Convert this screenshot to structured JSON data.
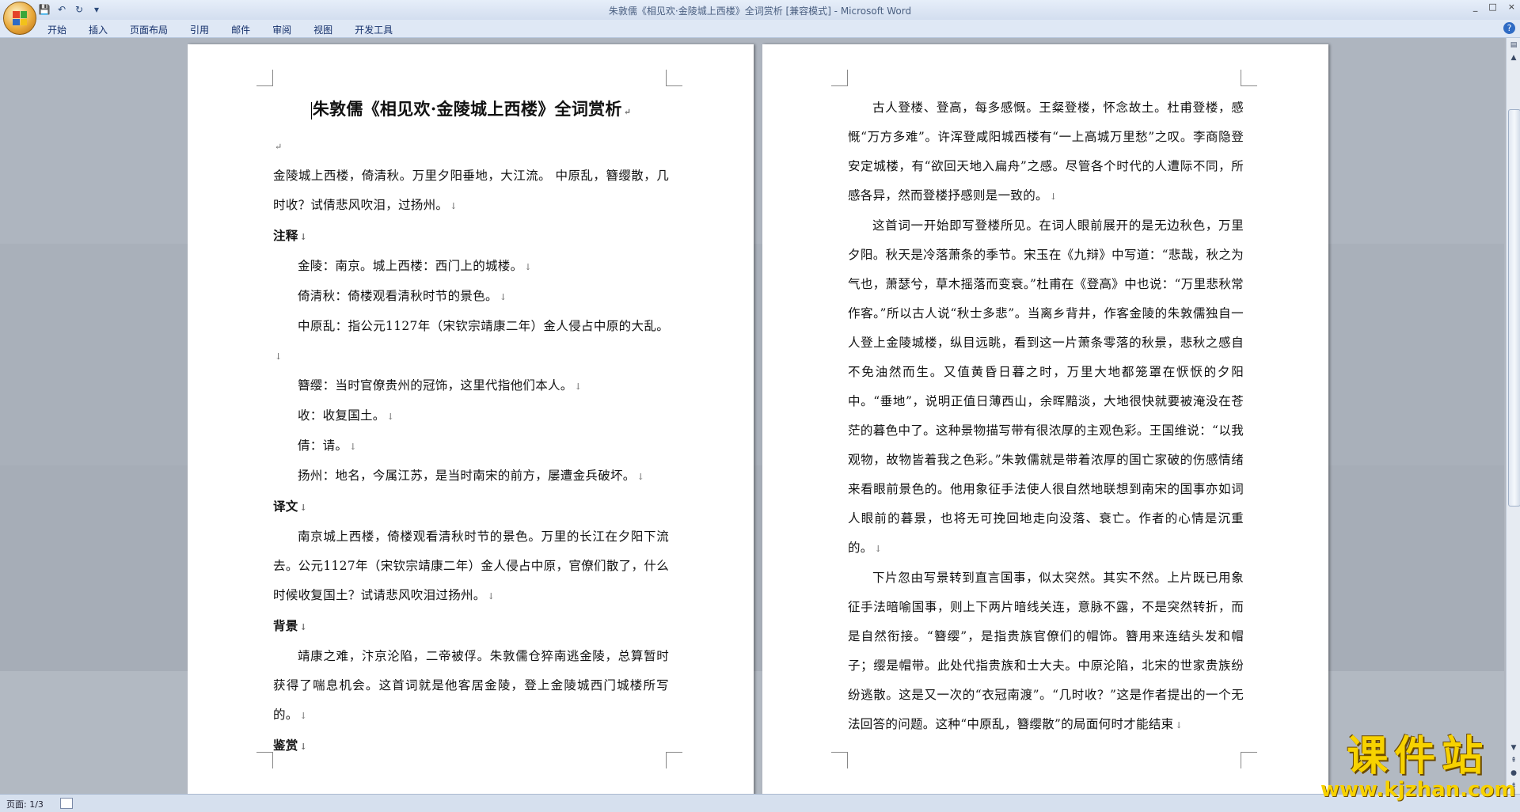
{
  "window": {
    "title": "朱敦儒《相见欢·金陵城上西楼》全词赏析 [兼容模式] - Microsoft Word",
    "controls": [
      "_",
      "□",
      "×"
    ],
    "help": "?"
  },
  "quick_access": {
    "save": "💾",
    "undo": "↶",
    "redo": "↻",
    "more": "▾"
  },
  "ribbon_tabs": [
    "开始",
    "插入",
    "页面布局",
    "引用",
    "邮件",
    "审阅",
    "视图",
    "开发工具"
  ],
  "page1": {
    "title": "朱敦儒《相见欢·金陵城上西楼》全词赏析",
    "paragraphs": [
      {
        "style": "plain",
        "text": "金陵城上西楼，倚清秋。万里夕阳垂地，大江流。 中原乱，簪缨散，几时收？试倩悲风吹泪，过扬州。"
      },
      {
        "style": "heading",
        "text": "注释"
      },
      {
        "style": "indent",
        "text": "金陵：南京。城上西楼：西门上的城楼。"
      },
      {
        "style": "indent",
        "text": "倚清秋：倚楼观看清秋时节的景色。"
      },
      {
        "style": "indent",
        "text": "中原乱：指公元1127年（宋钦宗靖康二年）金人侵占中原的大乱。"
      },
      {
        "style": "indent",
        "text": "簪缨：当时官僚贵州的冠饰，这里代指他们本人。"
      },
      {
        "style": "indent",
        "text": "收：收复国土。"
      },
      {
        "style": "indent",
        "text": "倩：请。"
      },
      {
        "style": "indent",
        "text": "扬州：地名，今属江苏，是当时南宋的前方，屡遭金兵破坏。"
      },
      {
        "style": "heading",
        "text": "译文"
      },
      {
        "style": "indent",
        "text": "南京城上西楼，倚楼观看清秋时节的景色。万里的长江在夕阳下流去。公元1127年（宋钦宗靖康二年）金人侵占中原，官僚们散了，什么时候收复国土？试请悲风吹泪过扬州。"
      },
      {
        "style": "heading",
        "text": "背景"
      },
      {
        "style": "indent",
        "text": "靖康之难，汴京沦陷，二帝被俘。朱敦儒仓猝南逃金陵，总算暂时获得了喘息机会。这首词就是他客居金陵，登上金陵城西门城楼所写的。"
      },
      {
        "style": "heading",
        "text": "鉴赏"
      }
    ]
  },
  "page2": {
    "paragraphs": [
      {
        "style": "indent",
        "text": "古人登楼、登高，每多感慨。王粲登楼，怀念故土。杜甫登楼，感慨“万方多难”。许浑登咸阳城西楼有“一上高城万里愁”之叹。李商隐登安定城楼，有“欲回天地入扁舟”之感。尽管各个时代的人遭际不同，所感各异，然而登楼抒感则是一致的。"
      },
      {
        "style": "indent",
        "text": "这首词一开始即写登楼所见。在词人眼前展开的是无边秋色，万里夕阳。秋天是冷落萧条的季节。宋玉在《九辩》中写道：“悲哉，秋之为气也，萧瑟兮，草木摇落而变衰。”杜甫在《登高》中也说：“万里悲秋常作客。”所以古人说“秋士多悲”。当离乡背井，作客金陵的朱敦儒独自一人登上金陵城楼，纵目远眺，看到这一片萧条零落的秋景，悲秋之感自不免油然而生。又值黄昏日暮之时，万里大地都笼罩在恹恹的夕阳中。“垂地”，说明正值日薄西山，余晖黯淡，大地很快就要被淹没在苍茫的暮色中了。这种景物描写带有很浓厚的主观色彩。王国维说：“以我观物，故物皆着我之色彩。”朱敦儒就是带着浓厚的国亡家破的伤感情绪来看眼前景色的。他用象征手法使人很自然地联想到南宋的国事亦如词人眼前的暮景，也将无可挽回地走向没落、衰亡。作者的心情是沉重的。"
      },
      {
        "style": "indent",
        "text": "下片忽由写景转到直言国事，似太突然。其实不然。上片既已用象征手法暗喻国事，则上下两片暗线关连，意脉不露，不是突然转折，而是自然衔接。“簪缨”，是指贵族官僚们的帽饰。簪用来连结头发和帽子；缨是帽带。此处代指贵族和士大夫。中原沦陷，北宋的世家贵族纷纷逃散。这是又一次的“衣冠南渡”。“几时收？”这是作者提出的一个无法回答的问题。这种“中原乱，簪缨散”的局面何时才能结束"
      }
    ]
  },
  "status": {
    "page": "页面: 1/3"
  },
  "watermark": {
    "text": "课件站",
    "url": "www.kjzhan.com"
  },
  "colors": {
    "office_orange": "#e9a93a",
    "ribbon_text": "#15306b",
    "watermark_yellow": "#f7d200"
  }
}
